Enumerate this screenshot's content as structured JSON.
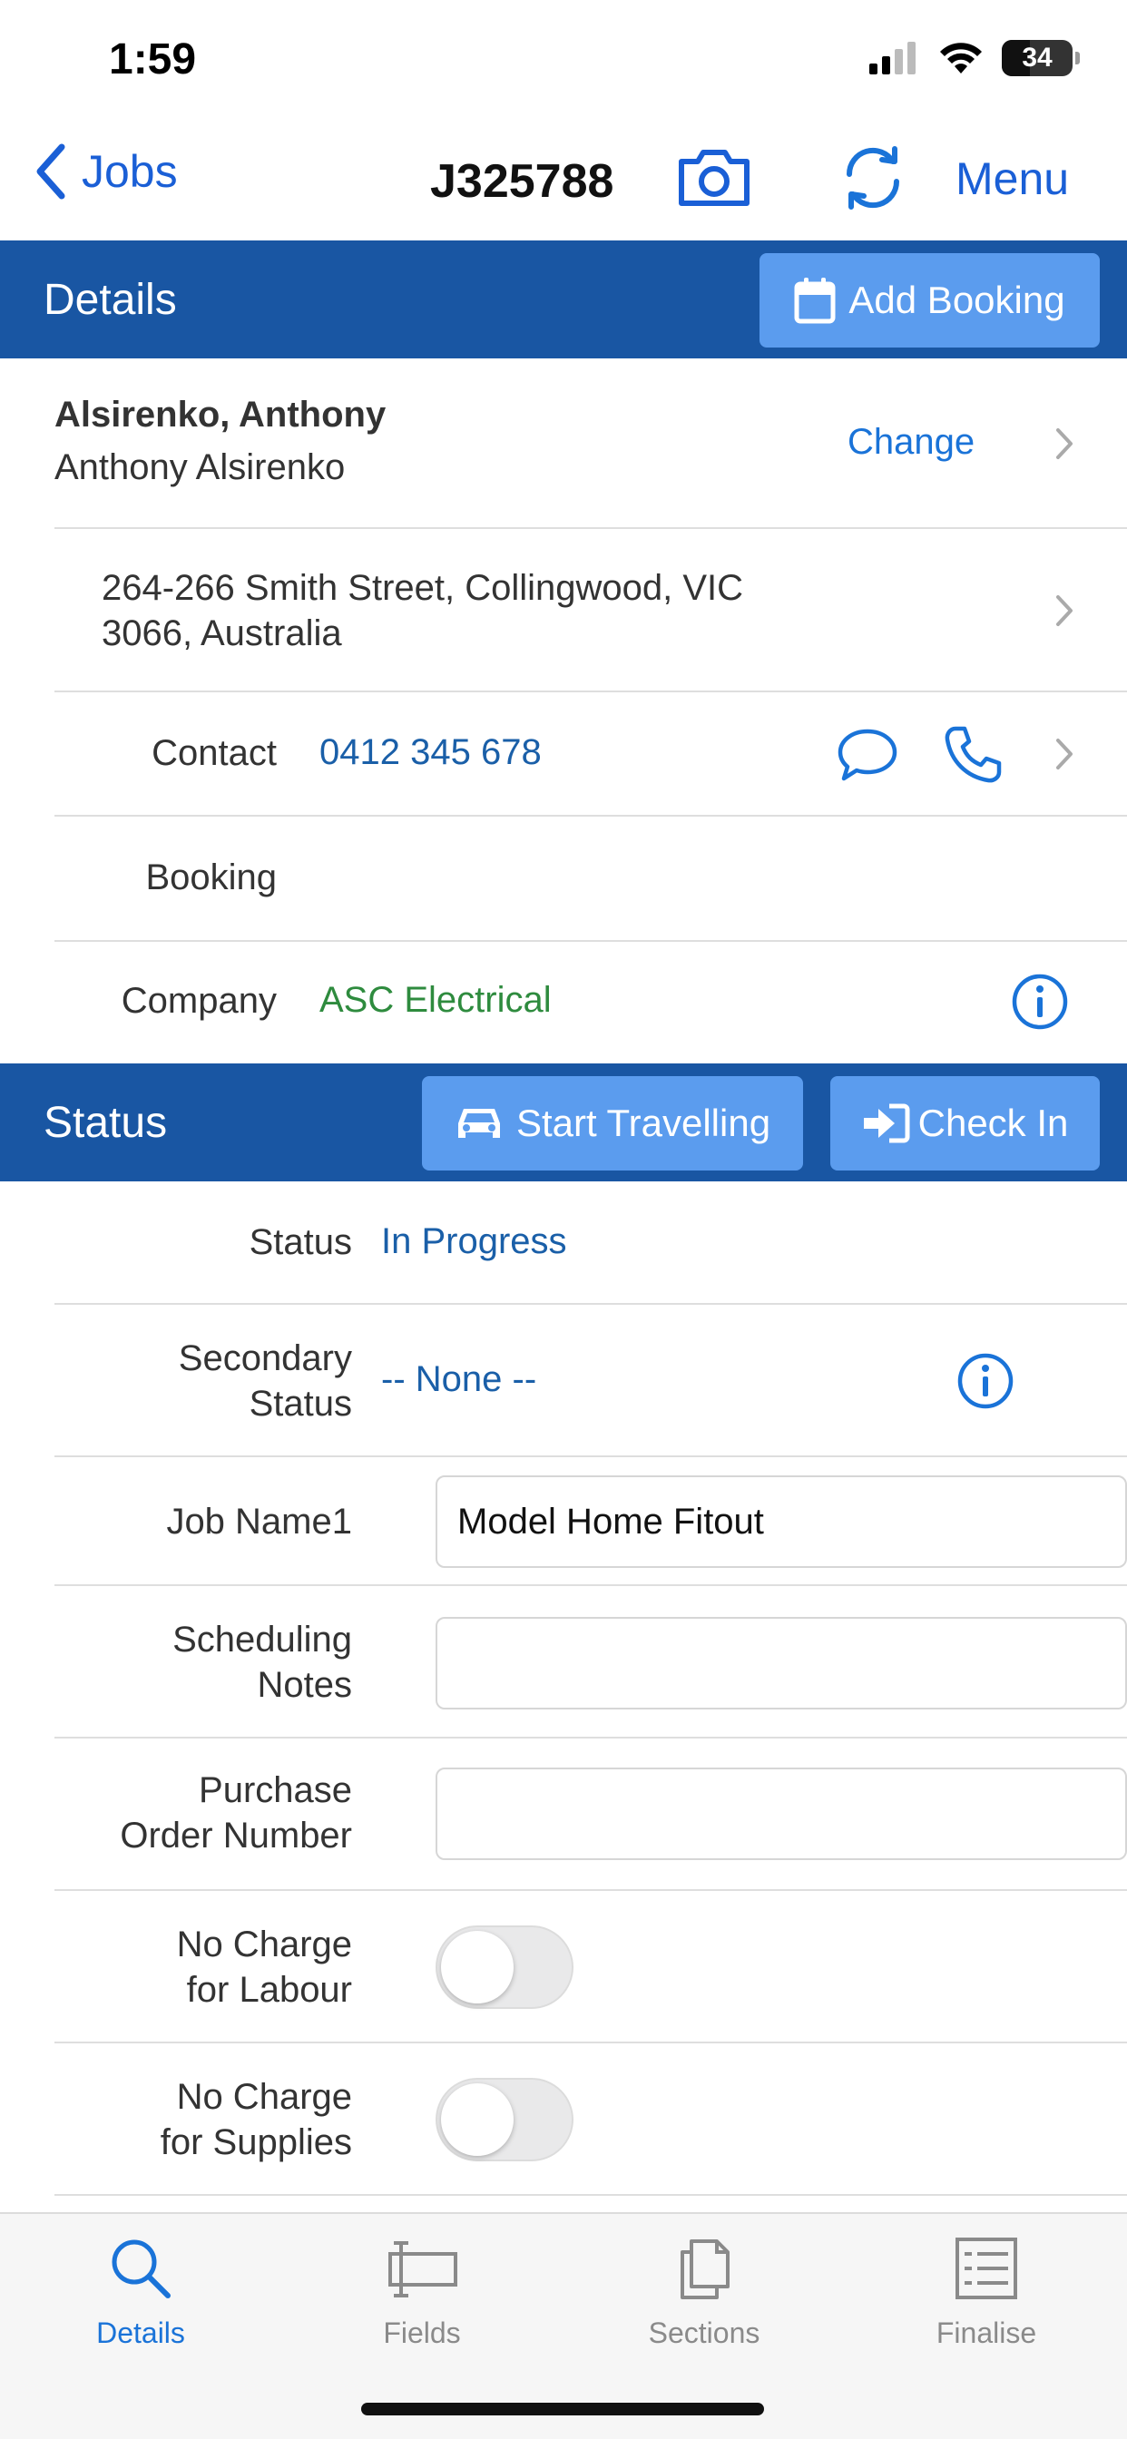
{
  "status_bar": {
    "time": "1:59",
    "battery": "34"
  },
  "nav": {
    "back_label": "Jobs",
    "title": "J325788",
    "menu_label": "Menu"
  },
  "details": {
    "header": "Details",
    "add_booking": "Add Booking",
    "customer_name": "Alsirenko, Anthony",
    "customer_display": "Anthony Alsirenko",
    "change_label": "Change",
    "address_line1": "264-266 Smith Street, Collingwood, VIC",
    "address_line2": "3066, Australia",
    "contact_label": "Contact",
    "contact_value": "0412 345 678",
    "booking_label": "Booking",
    "company_label": "Company",
    "company_value": "ASC Electrical"
  },
  "status": {
    "header": "Status",
    "start_travelling": "Start Travelling",
    "check_in": "Check In",
    "status_label": "Status",
    "status_value": "In Progress",
    "secondary_label_1": "Secondary",
    "secondary_label_2": "Status",
    "secondary_value": "-- None --",
    "job_name_label": "Job Name1",
    "job_name_value": "Model Home Fitout",
    "sched_label_1": "Scheduling",
    "sched_label_2": "Notes",
    "sched_value": "",
    "po_label_1": "Purchase",
    "po_label_2": "Order Number",
    "po_value": "",
    "no_labour_1": "No Charge",
    "no_labour_2": "for Labour",
    "no_supplies_1": "No Charge",
    "no_supplies_2": "for Supplies"
  },
  "tabs": [
    {
      "label": "Details",
      "icon": "search-icon"
    },
    {
      "label": "Fields",
      "icon": "fields-icon"
    },
    {
      "label": "Sections",
      "icon": "sections-icon"
    },
    {
      "label": "Finalise",
      "icon": "checklist-icon"
    }
  ],
  "colors": {
    "primary": "#1956a3",
    "button": "#5b9cee",
    "link": "#1a5fd6",
    "company": "#2e8b3e"
  }
}
